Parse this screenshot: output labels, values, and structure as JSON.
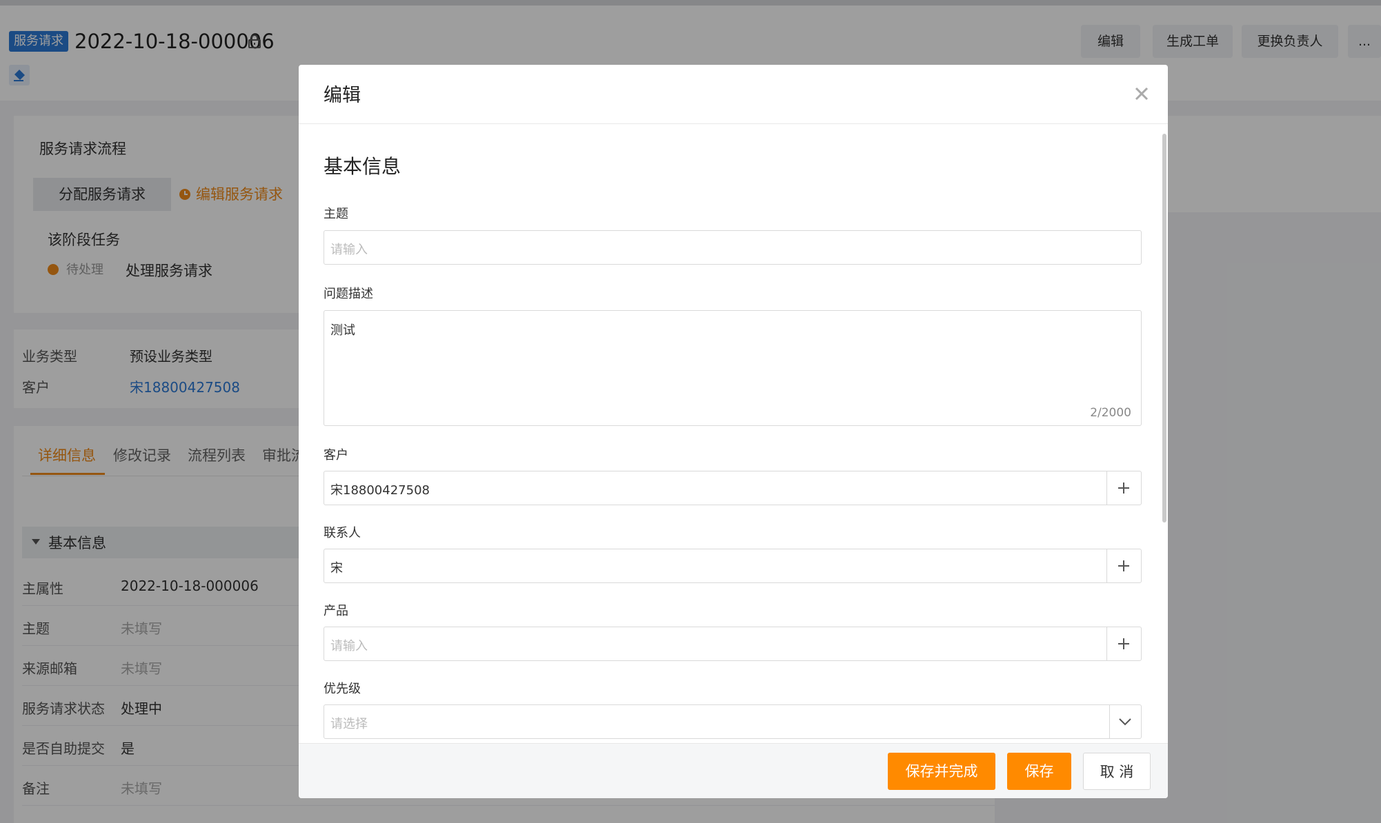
{
  "header": {
    "type_tag": "服务请求",
    "record_id": "2022-10-18-000006",
    "actions": [
      "编辑",
      "生成工单",
      "更换负责人",
      "..."
    ]
  },
  "flow": {
    "title": "服务请求流程",
    "stages": [
      "分配服务请求",
      "编辑服务请求"
    ],
    "stage_tasks_label": "该阶段任务",
    "task_status": "待处理",
    "task_name": "处理服务请求"
  },
  "summary": [
    {
      "label": "业务类型",
      "value": "预设业务类型"
    },
    {
      "label": "客户",
      "value": "宋18800427508"
    }
  ],
  "tabs": [
    "详细信息",
    "修改记录",
    "流程列表",
    "审批流"
  ],
  "detail": {
    "section_title": "基本信息",
    "rows": [
      {
        "label": "主属性",
        "value": "2022-10-18-000006"
      },
      {
        "label": "主题",
        "value": "未填写"
      },
      {
        "label": "来源邮箱",
        "value": "未填写"
      },
      {
        "label": "服务请求状态",
        "value": "处理中"
      },
      {
        "label": "是否自助提交",
        "value": "是"
      },
      {
        "label": "备注",
        "value": "未填写"
      }
    ]
  },
  "modal": {
    "title": "编辑",
    "section_title": "基本信息",
    "fields": {
      "subject": {
        "label": "主题",
        "placeholder": "请输入",
        "value": ""
      },
      "description": {
        "label": "问题描述",
        "value": "测试",
        "counter": "2/2000"
      },
      "customer": {
        "label": "客户",
        "value": "宋18800427508"
      },
      "contact": {
        "label": "联系人",
        "value": "宋"
      },
      "product": {
        "label": "产品",
        "placeholder": "请输入",
        "value": ""
      },
      "priority": {
        "label": "优先级",
        "placeholder": "请选择",
        "value": ""
      }
    },
    "buttons": {
      "save_complete": "保存并完成",
      "save": "保存",
      "cancel": "取 消"
    }
  },
  "colors": {
    "accent": "#ff8a00",
    "link": "#2d7ad6",
    "tag_bg": "#2d7ad6"
  }
}
